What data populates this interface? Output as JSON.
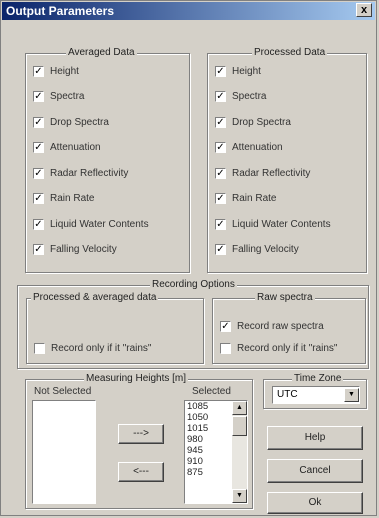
{
  "window": {
    "title": "Output Parameters",
    "close_glyph": "x"
  },
  "averaged": {
    "legend": "Averaged Data",
    "items": [
      {
        "label": "Height",
        "checked": true
      },
      {
        "label": "Spectra",
        "checked": true
      },
      {
        "label": "Drop Spectra",
        "checked": true
      },
      {
        "label": "Attenuation",
        "checked": true
      },
      {
        "label": "Radar Reflectivity",
        "checked": true
      },
      {
        "label": "Rain Rate",
        "checked": true
      },
      {
        "label": "Liquid Water Contents",
        "checked": true
      },
      {
        "label": "Falling Velocity",
        "checked": true
      }
    ]
  },
  "processed": {
    "legend": "Processed Data",
    "items": [
      {
        "label": "Height",
        "checked": true
      },
      {
        "label": "Spectra",
        "checked": true
      },
      {
        "label": "Drop Spectra",
        "checked": true
      },
      {
        "label": "Attenuation",
        "checked": true
      },
      {
        "label": "Radar Reflectivity",
        "checked": true
      },
      {
        "label": "Rain Rate",
        "checked": true
      },
      {
        "label": "Liquid Water Contents",
        "checked": true
      },
      {
        "label": "Falling Velocity",
        "checked": true
      }
    ]
  },
  "recording": {
    "legend": "Recording Options",
    "left_legend": "Processed & averaged data",
    "left_item": {
      "label": "Record only if it \"rains\"",
      "checked": false
    },
    "right_legend": "Raw spectra",
    "right_items": [
      {
        "label": "Record raw spectra",
        "checked": true
      },
      {
        "label": "Record only if it \"rains\"",
        "checked": false
      }
    ]
  },
  "heights": {
    "legend": "Measuring Heights [m]",
    "not_selected_label": "Not Selected",
    "selected_label": "Selected",
    "add_label": "--->",
    "remove_label": "<---",
    "selected_values": [
      "1085",
      "1050",
      "1015",
      "980",
      "945",
      "910",
      "875"
    ],
    "not_selected_values": []
  },
  "timezone": {
    "legend": "Time Zone",
    "value": "UTC"
  },
  "buttons": {
    "help": "Help",
    "cancel": "Cancel",
    "ok": "Ok"
  },
  "glyphs": {
    "check": "✓",
    "arrow_up": "▲",
    "arrow_down": "▼"
  }
}
